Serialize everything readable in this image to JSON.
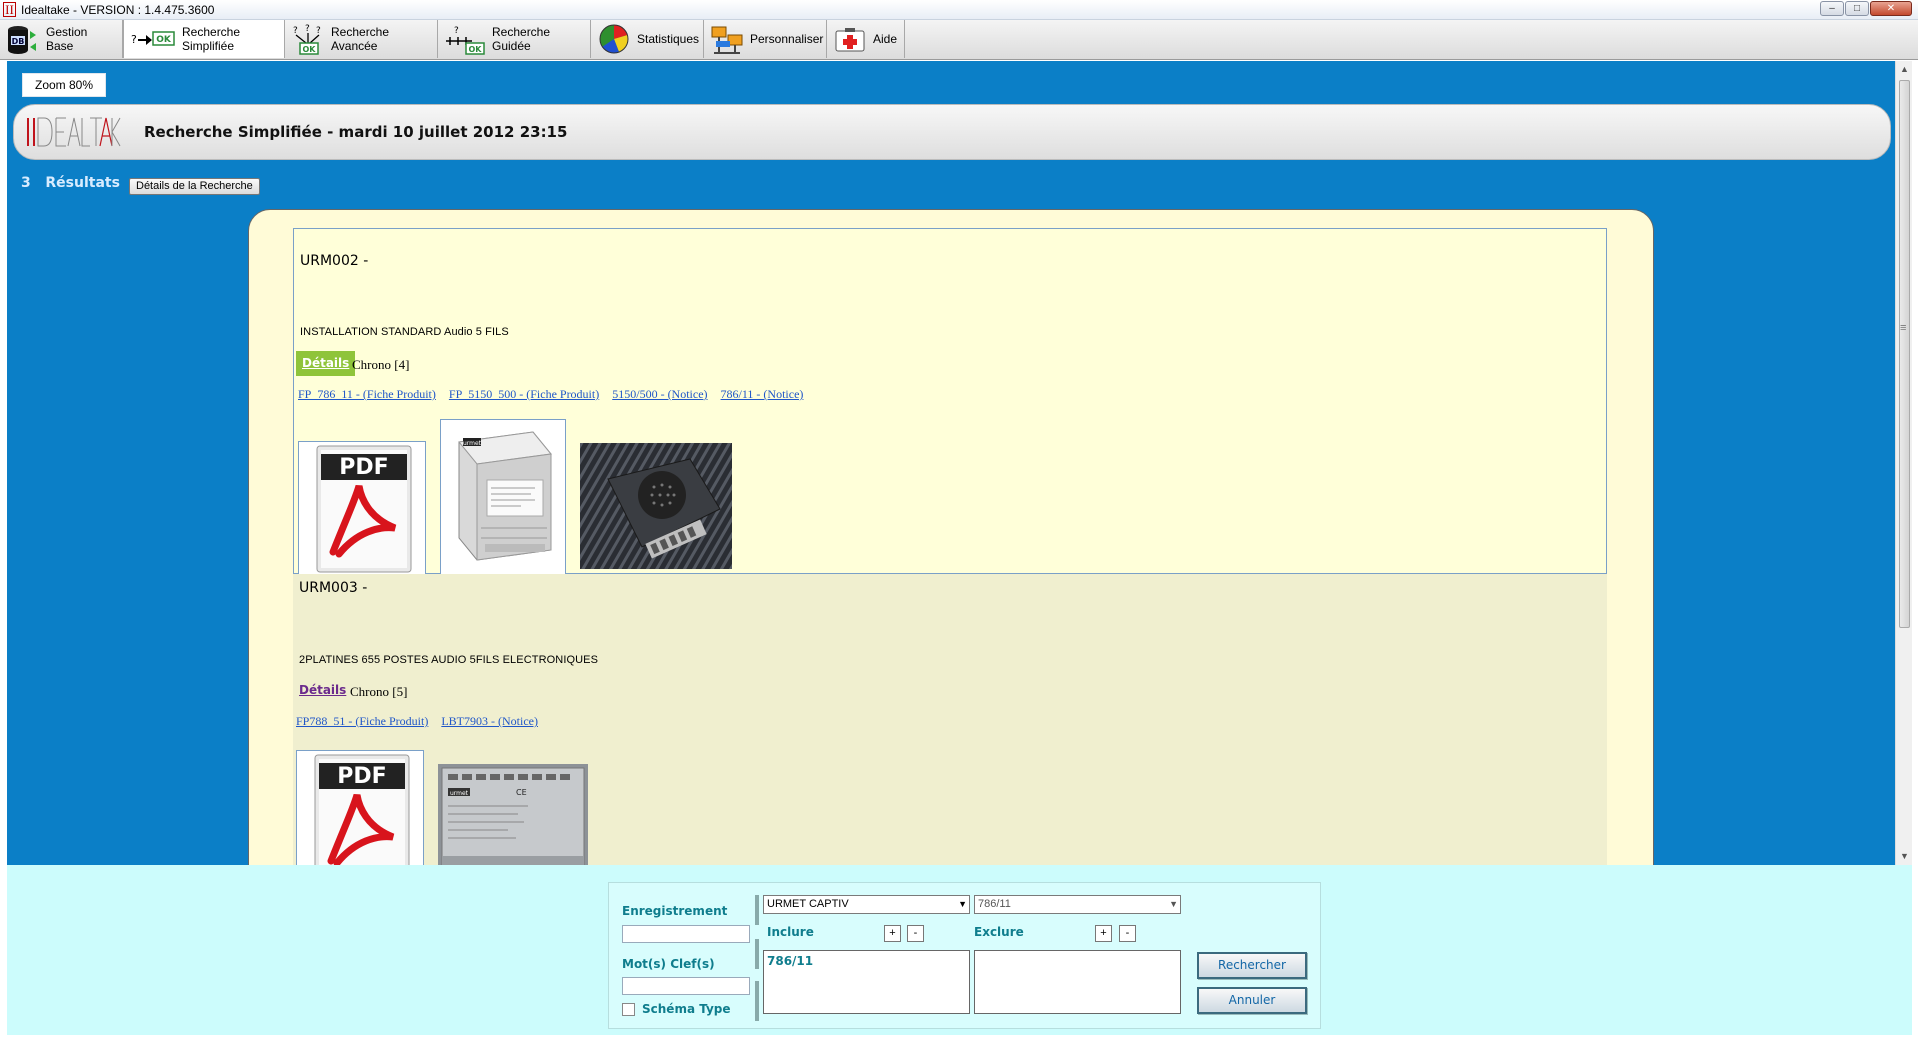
{
  "window": {
    "title": "Idealtake - VERSION : 1.4.475.3600",
    "app_icon": "II",
    "minimize": "–",
    "maximize": "□",
    "close": "✕"
  },
  "toolbar": {
    "items": [
      {
        "label": "Gestion Base",
        "icon": "database-icon"
      },
      {
        "label": "Recherche Simplifiée",
        "icon": "ok-arrow-icon"
      },
      {
        "label": "Recherche Avancée",
        "icon": "advanced-search-icon"
      },
      {
        "label": "Recherche Guidée",
        "icon": "guided-search-icon"
      },
      {
        "label": "Statistiques",
        "icon": "pie-chart-icon"
      },
      {
        "label": "Personnaliser",
        "icon": "customize-icon"
      },
      {
        "label": "Aide",
        "icon": "first-aid-icon"
      }
    ]
  },
  "page": {
    "zoom_label": "Zoom 80%",
    "header_title": "Recherche Simplifiée - mardi 10 juillet 2012 23:15",
    "results_count": "3",
    "results_label": "Résultats",
    "details_search_button": "Détails de la Recherche",
    "logo_text": "IDEALTAKE"
  },
  "results": [
    {
      "code": "URM002 -",
      "description": "INSTALLATION STANDARD Audio 5 FILS",
      "details": "Détails",
      "chrono": "Chrono [4]",
      "links": [
        "FP_786_11 - (Fiche Produit)",
        "FP_5150_500 - (Fiche Produit)",
        "5150/500 - (Notice)",
        "786/11 - (Notice)"
      ]
    },
    {
      "code": "URM003 -",
      "description": "2PLATINES 655 POSTES AUDIO 5FILS ELECTRONIQUES",
      "details": "Détails",
      "chrono": "Chrono [5]",
      "links": [
        "FP788_51 - (Fiche Produit)",
        "LBT7903 - (Notice)"
      ]
    }
  ],
  "thumbnails": {
    "pdf_text": "PDF",
    "brand_text": "urmet",
    "ce_mark": "CE"
  },
  "search": {
    "enregistrement_label": "Enregistrement",
    "enregistrement_value": "",
    "motsclefs_label": "Mot(s) Clef(s)",
    "motsclefs_value": "",
    "schema_type_label": "Schéma Type",
    "schema_type_checked": false,
    "brand_select": "URMET CAPTIV",
    "ref_select": "786/11",
    "inclure_label": "Inclure",
    "exclure_label": "Exclure",
    "plus": "+",
    "minus": "-",
    "inclure_value": "786/11",
    "exclure_value": "",
    "search_button": "Rechercher",
    "cancel_button": "Annuler",
    "dropdown_arrow": "▼"
  },
  "scrollbar": {
    "up": "▲",
    "down": "▼",
    "grip": "≡"
  }
}
